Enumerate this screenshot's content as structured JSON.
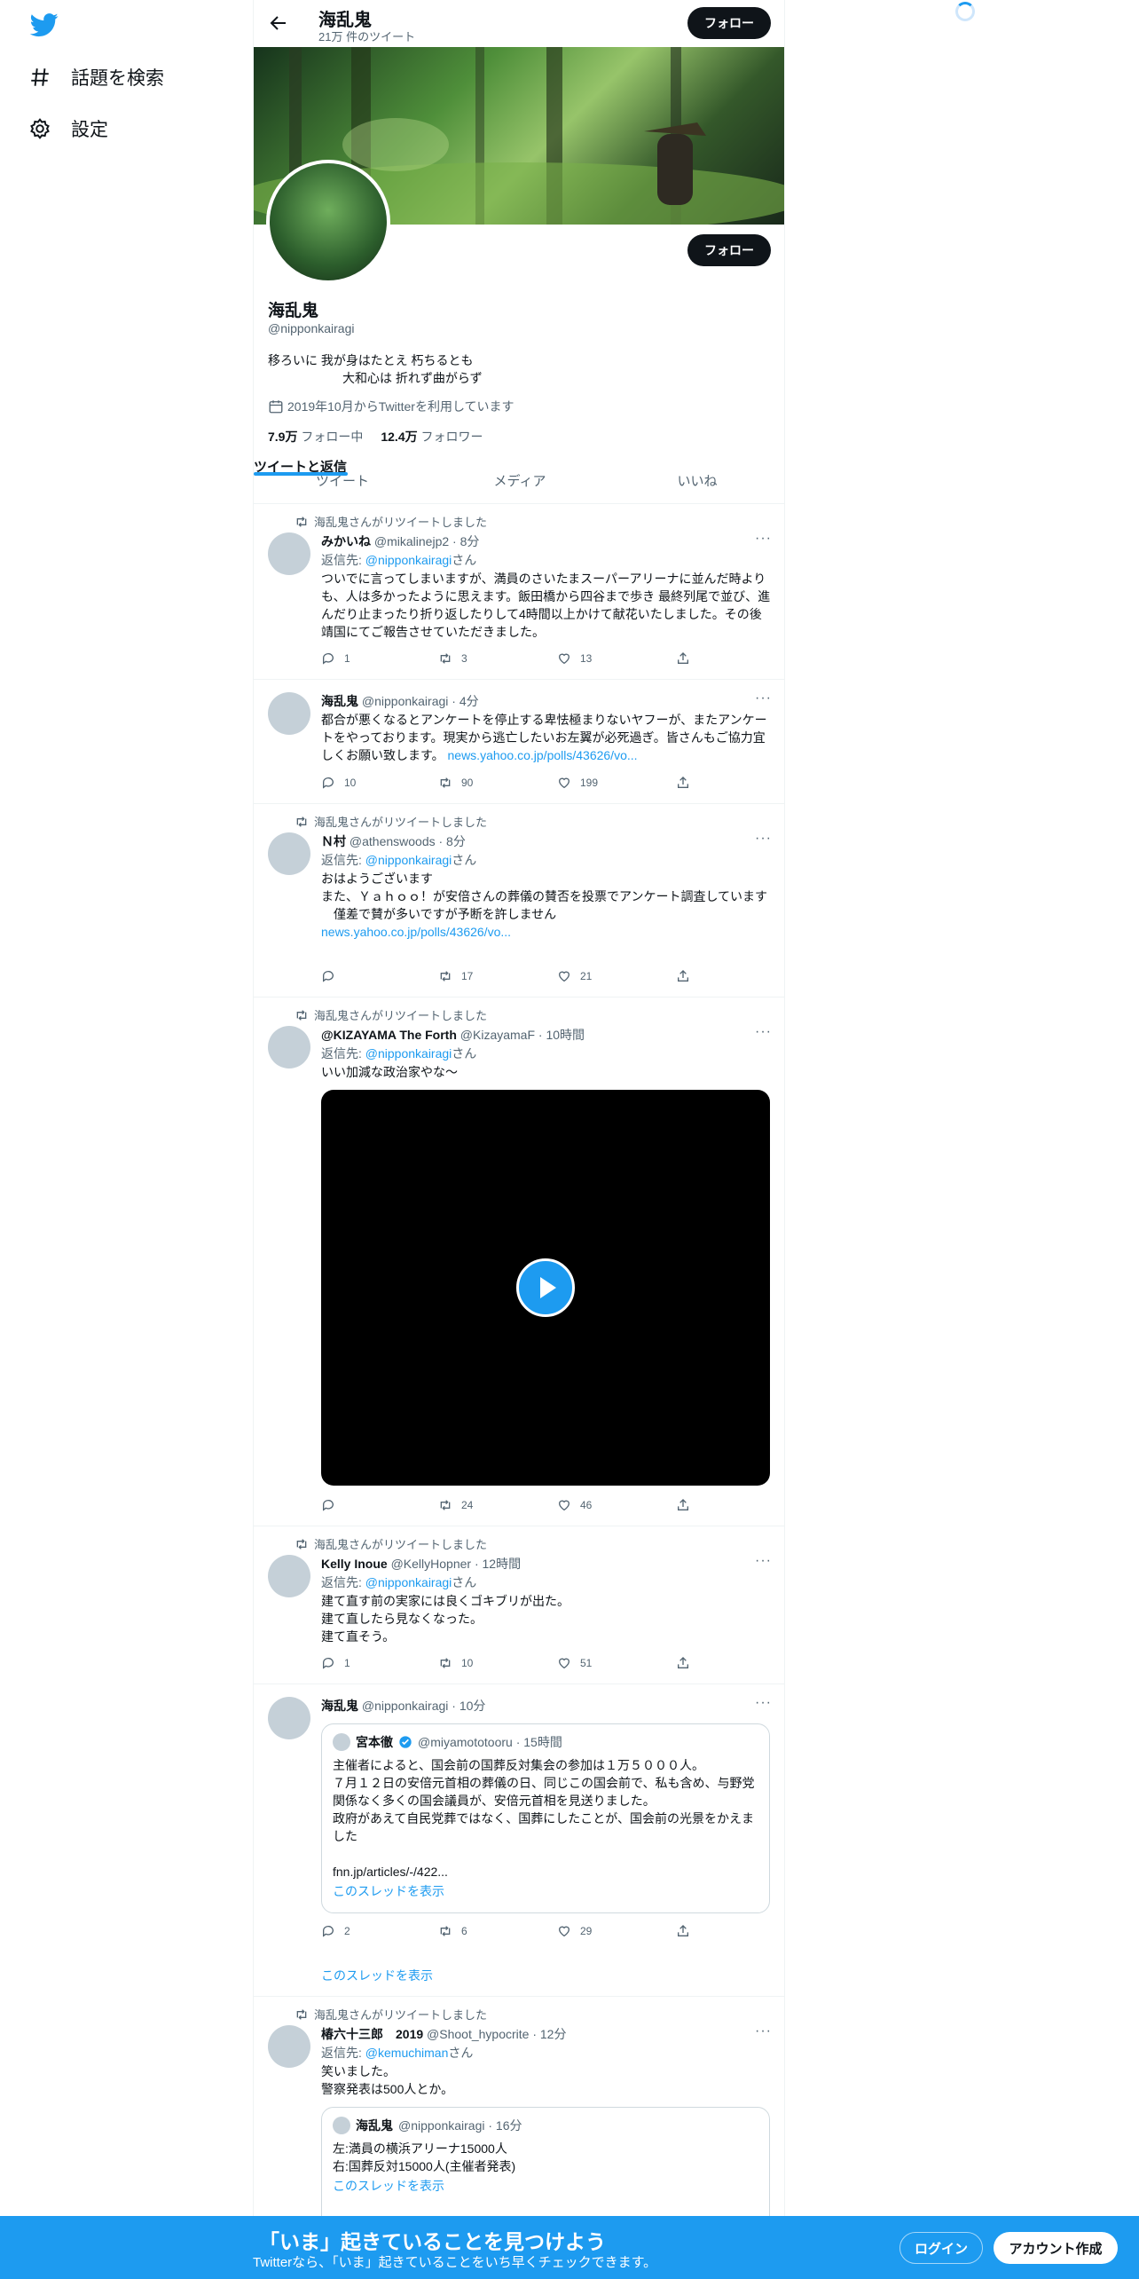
{
  "sidebar": {
    "explore": "話題を検索",
    "settings": "設定"
  },
  "header": {
    "name": "海乱鬼",
    "count": "21万 件のツイート",
    "follow": "フォロー"
  },
  "profile": {
    "name": "海乱鬼",
    "handle": "@nipponkairagi",
    "bio": "移ろいに 我が身はたとえ 朽ちるとも\n　　　　　　大和心は 折れず曲がらず",
    "joined": "2019年10月からTwitterを利用しています",
    "following_num": "7.9万",
    "following_label": "フォロー中",
    "followers_num": "12.4万",
    "followers_label": "フォロワー",
    "follow": "フォロー"
  },
  "tabs": [
    "ツイート",
    "ツイートと返信",
    "メディア",
    "いいね"
  ],
  "tweets": [
    {
      "rt": "海乱鬼さんがリツイートしました",
      "name": "みかいね",
      "meta": "@mikalinejp2 · 8分",
      "reply_prefix": "返信先: ",
      "reply_to": "@nipponkairagi",
      "reply_suffix": "さん",
      "body": "ついでに言ってしまいますが、満員のさいたまスーパーアリーナに並んだ時よりも、人は多かったように思えます。飯田橋から四谷まで歩き 最終列尾で並び、進んだり止まったり折り返したりして4時間以上かけて献花いたしました。その後靖国にてご報告させていただきました。",
      "reply": "1",
      "retweet": "3",
      "like": "13"
    },
    {
      "name": "海乱鬼",
      "meta": "@nipponkairagi · 4分",
      "body": "都合が悪くなるとアンケートを停止する卑怯極まりないヤフーが、またアンケートをやっております。現実から逃亡したいお左翼が必死過ぎ。皆さんもご協力宜しくお願い致します。",
      "link": "news.yahoo.co.jp/polls/43626/vo...",
      "reply": "10",
      "retweet": "90",
      "like": "199"
    },
    {
      "rt": "海乱鬼さんがリツイートしました",
      "name": "Ｎ村",
      "meta": "@athenswoods · 8分",
      "reply_prefix": "返信先: ",
      "reply_to": "@nipponkairagi",
      "reply_suffix": "さん",
      "body": "おはようございます\nまた、Ｙａｈｏｏ！が安倍さんの葬儀の賛否を投票でアンケート調査しています\n　僅差で賛が多いですが予断を許しません",
      "link": "news.yahoo.co.jp/polls/43626/vo...",
      "reply": "",
      "retweet": "17",
      "like": "21"
    },
    {
      "rt": "海乱鬼さんがリツイートしました",
      "name": "@KIZAYAMA The Forth",
      "meta": "@KizayamaF · 10時間",
      "reply_prefix": "返信先: ",
      "reply_to": "@nipponkairagi",
      "reply_suffix": "さん",
      "body": "いい加減な政治家やな～",
      "reply": "",
      "retweet": "24",
      "like": "46"
    },
    {
      "rt": "海乱鬼さんがリツイートしました",
      "name": "Kelly Inoue",
      "meta": "@KellyHopner · 12時間",
      "reply_prefix": "返信先: ",
      "reply_to": "@nipponkairagi",
      "reply_suffix": "さん",
      "body": "建て直す前の実家には良くゴキブリが出た。\n建て直したら見なくなった。\n建て直そう。",
      "reply": "1",
      "retweet": "10",
      "like": "51"
    },
    {
      "name": "海乱鬼",
      "meta": "@nipponkairagi · 10分",
      "quote_name": "宮本徹",
      "quote_meta": "@miyamototooru · 15時間",
      "quote_body": "主催者によると、国会前の国葬反対集会の参加は１万５０００人。\n７月１２日の安倍元首相の葬儀の日、同じこの国会前で、私も含め、与野党関係なく多くの国会議員が、安倍元首相を見送りました。\n政府があえて自民党葬ではなく、国葬にしたことが、国会前の光景をかえました\n\nfnn.jp/articles/-/422...",
      "quote_thread": "このスレッドを表示",
      "reply": "2",
      "retweet": "6",
      "like": "29",
      "thread": "このスレッドを表示"
    },
    {
      "rt": "海乱鬼さんがリツイートしました",
      "name": "椿六十三郎　2019",
      "meta": "@Shoot_hypocrite · 12分",
      "reply_prefix": "返信先: ",
      "reply_to": "@kemuchiman",
      "reply_suffix": "さん",
      "body": "笑いました。\n警察発表は500人とか。",
      "quote_name": "海乱鬼",
      "quote_meta": "@nipponkairagi · 16分",
      "quote_body": "左:満員の横浜アリーナ15000人\n右:国葬反対15000人(主催者発表)",
      "quote_thread": "このスレッドを表示"
    }
  ],
  "bottom": {
    "title": "「いま」起きていることを見つけよう",
    "sub": "Twitterなら、「いま」起きていることをいち早くチェックできます。",
    "login": "ログイン",
    "signup": "アカウント作成"
  }
}
